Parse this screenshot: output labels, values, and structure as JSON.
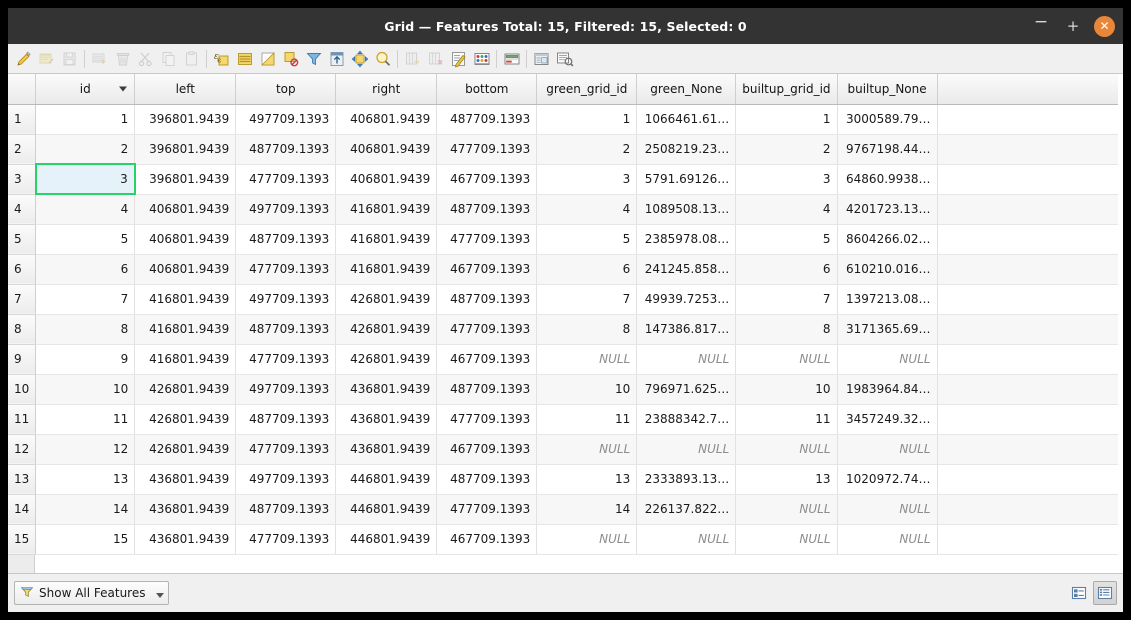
{
  "window": {
    "title": "Grid — Features Total: 15, Filtered: 15, Selected: 0",
    "minimize_label": "−",
    "maximize_label": "+",
    "close_label": "✕",
    "close_color": "#e8873a",
    "titlebar_color": "#333333"
  },
  "toolbar": {
    "items": [
      {
        "name": "toggle-editing-icon",
        "label": "Toggle editing mode",
        "enabled": true
      },
      {
        "name": "save-edits-icon",
        "label": "Save edits",
        "enabled": false
      },
      {
        "name": "reload-table-icon",
        "label": "Reload the table",
        "enabled": false
      },
      {
        "sep": true
      },
      {
        "name": "add-feature-icon",
        "label": "Add feature",
        "enabled": false
      },
      {
        "name": "delete-selected-icon",
        "label": "Delete selected features",
        "enabled": false
      },
      {
        "name": "cut-features-icon",
        "label": "Cut selected rows to clipboard",
        "enabled": false
      },
      {
        "name": "copy-features-icon",
        "label": "Copy selected rows to clipboard",
        "enabled": false
      },
      {
        "name": "paste-features-icon",
        "label": "Paste features from clipboard",
        "enabled": false
      },
      {
        "sep": true
      },
      {
        "name": "select-by-expression-icon",
        "label": "Select features using an expression",
        "enabled": true
      },
      {
        "name": "select-all-icon",
        "label": "Select all",
        "enabled": true
      },
      {
        "name": "invert-selection-icon",
        "label": "Invert selection",
        "enabled": true
      },
      {
        "name": "deselect-all-icon",
        "label": "Deselect all",
        "enabled": true
      },
      {
        "name": "filter-selection-icon",
        "label": "Filter / select features using form",
        "enabled": true
      },
      {
        "name": "move-selection-to-top-icon",
        "label": "Move selection to top",
        "enabled": true
      },
      {
        "name": "pan-map-to-selected-icon",
        "label": "Pan map to the selected rows",
        "enabled": true
      },
      {
        "name": "zoom-map-to-selected-icon",
        "label": "Zoom map to the selected rows",
        "enabled": true
      },
      {
        "sep": true
      },
      {
        "name": "new-field-icon",
        "label": "New field",
        "enabled": false
      },
      {
        "name": "delete-field-icon",
        "label": "Delete field",
        "enabled": false
      },
      {
        "name": "open-field-calculator-icon",
        "label": "Open field calculator",
        "enabled": true
      },
      {
        "name": "conditional-formatting-icon",
        "label": "Conditional formatting",
        "enabled": true
      },
      {
        "sep": true
      },
      {
        "name": "organize-columns-icon",
        "label": "Organize columns",
        "enabled": true
      },
      {
        "sep": true
      },
      {
        "name": "actions-icon",
        "label": "Actions",
        "enabled": true
      },
      {
        "name": "form-view-toggle-icon",
        "label": "Switch to form view",
        "enabled": true
      }
    ]
  },
  "table": {
    "columns": [
      "id",
      "left",
      "top",
      "right",
      "bottom",
      "green_grid_id",
      "green_None",
      "builtup_grid_id",
      "builtup_None"
    ],
    "sorted_column": "id",
    "sort_direction": "descending-indicator",
    "null_label": "NULL",
    "selected_cell": {
      "row": 3,
      "column": "id"
    },
    "selection_border_color": "#25d366",
    "selection_fill_color": "#e6f2fa",
    "row_headers": [
      "1",
      "2",
      "3",
      "4",
      "5",
      "6",
      "7",
      "8",
      "9",
      "10",
      "11",
      "12",
      "13",
      "14",
      "15"
    ],
    "rows": [
      [
        "1",
        "396801.9439",
        "497709.1393",
        "406801.9439",
        "487709.1393",
        "1",
        "1066461.61…",
        "1",
        "3000589.79…"
      ],
      [
        "2",
        "396801.9439",
        "487709.1393",
        "406801.9439",
        "477709.1393",
        "2",
        "2508219.23…",
        "2",
        "9767198.44…"
      ],
      [
        "3",
        "396801.9439",
        "477709.1393",
        "406801.9439",
        "467709.1393",
        "3",
        "5791.69126…",
        "3",
        "64860.9938…"
      ],
      [
        "4",
        "406801.9439",
        "497709.1393",
        "416801.9439",
        "487709.1393",
        "4",
        "1089508.13…",
        "4",
        "4201723.13…"
      ],
      [
        "5",
        "406801.9439",
        "487709.1393",
        "416801.9439",
        "477709.1393",
        "5",
        "2385978.08…",
        "5",
        "8604266.02…"
      ],
      [
        "6",
        "406801.9439",
        "477709.1393",
        "416801.9439",
        "467709.1393",
        "6",
        "241245.858…",
        "6",
        "610210.016…"
      ],
      [
        "7",
        "416801.9439",
        "497709.1393",
        "426801.9439",
        "487709.1393",
        "7",
        "49939.7253…",
        "7",
        "1397213.08…"
      ],
      [
        "8",
        "416801.9439",
        "487709.1393",
        "426801.9439",
        "477709.1393",
        "8",
        "147386.817…",
        "8",
        "3171365.69…"
      ],
      [
        "9",
        "416801.9439",
        "477709.1393",
        "426801.9439",
        "467709.1393",
        "NULL",
        "NULL",
        "NULL",
        "NULL"
      ],
      [
        "10",
        "426801.9439",
        "497709.1393",
        "436801.9439",
        "487709.1393",
        "10",
        "796971.625…",
        "10",
        "1983964.84…"
      ],
      [
        "11",
        "426801.9439",
        "487709.1393",
        "436801.9439",
        "477709.1393",
        "11",
        "23888342.7…",
        "11",
        "3457249.32…"
      ],
      [
        "12",
        "426801.9439",
        "477709.1393",
        "436801.9439",
        "467709.1393",
        "NULL",
        "NULL",
        "NULL",
        "NULL"
      ],
      [
        "13",
        "436801.9439",
        "497709.1393",
        "446801.9439",
        "487709.1393",
        "13",
        "2333893.13…",
        "13",
        "1020972.74…"
      ],
      [
        "14",
        "436801.9439",
        "487709.1393",
        "446801.9439",
        "477709.1393",
        "14",
        "226137.822…",
        "NULL",
        "NULL"
      ],
      [
        "15",
        "436801.9439",
        "477709.1393",
        "446801.9439",
        "467709.1393",
        "NULL",
        "NULL",
        "NULL",
        "NULL"
      ]
    ]
  },
  "statusbar": {
    "filter_label": "Show All Features",
    "filter_icon": "funnel-icon",
    "form_view_button": "form-view-icon",
    "table_view_button": "table-view-icon",
    "active_view": "table-view"
  }
}
